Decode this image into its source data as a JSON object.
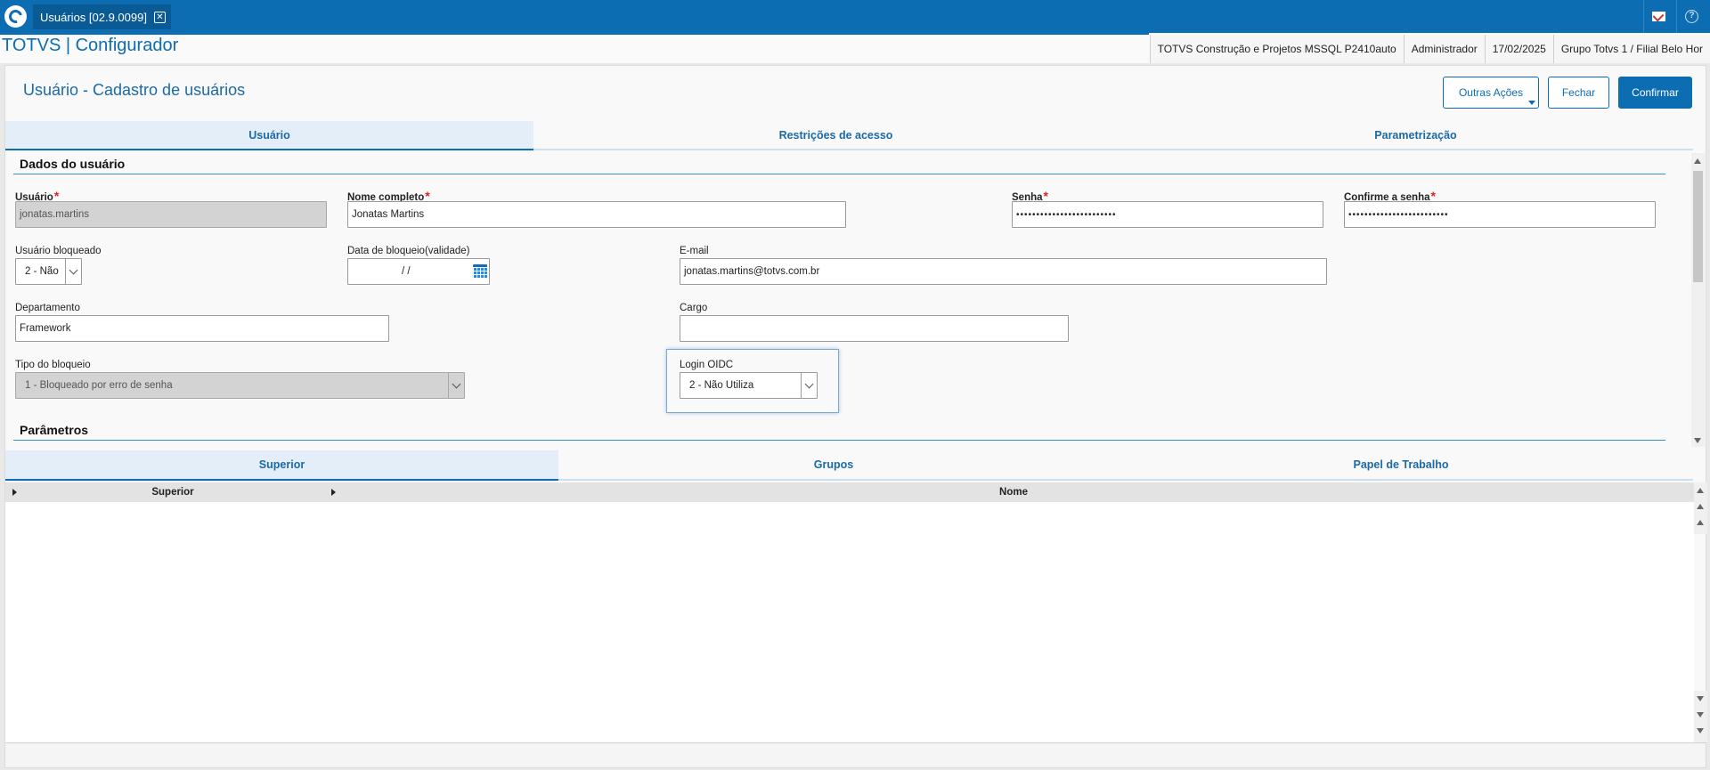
{
  "window": {
    "tab_title": "Usuários [02.9.0099]",
    "close_glyph": "✕",
    "help_glyph": "?"
  },
  "header": {
    "app_title": "TOTVS | Configurador",
    "environment": "TOTVS Construção e Projetos MSSQL P2410auto",
    "user": "Administrador",
    "date": "17/02/2025",
    "company": "Grupo Totvs 1 / Filial Belo Hor"
  },
  "form": {
    "title": "Usuário - Cadastro de usuários",
    "buttons": {
      "other_actions": "Outras Ações",
      "close": "Fechar",
      "confirm": "Confirmar"
    }
  },
  "tabs": [
    {
      "label": "Usuário",
      "active": true
    },
    {
      "label": "Restrições de acesso",
      "active": false
    },
    {
      "label": "Parametrização",
      "active": false
    }
  ],
  "user_section": {
    "title": "Dados do usuário",
    "required_mark": "*",
    "fields": {
      "usuario": {
        "label": "Usuário",
        "value": "jonatas.martins"
      },
      "nome_completo": {
        "label": "Nome completo",
        "value": "Jonatas Martins"
      },
      "senha": {
        "label": "Senha",
        "value": "•••••••••••••••••••••••••"
      },
      "confirme_senha": {
        "label": "Confirme a senha",
        "value": "•••••••••••••••••••••••••"
      },
      "usuario_bloqueado": {
        "label": "Usuário bloqueado",
        "value": "2 - Não"
      },
      "data_bloqueio": {
        "label": "Data de bloqueio(validade)",
        "value": "/ /"
      },
      "email": {
        "label": "E-mail",
        "value": "jonatas.martins@totvs.com.br"
      },
      "departamento": {
        "label": "Departamento",
        "value": "Framework"
      },
      "cargo": {
        "label": "Cargo",
        "value": ""
      },
      "tipo_bloqueio": {
        "label": "Tipo do bloqueio",
        "value": "1 - Bloqueado por erro de senha"
      },
      "login_oidc": {
        "label": "Login OIDC",
        "value": "2 - Não Utiliza"
      }
    }
  },
  "params_section": {
    "title": "Parâmetros",
    "tabs": [
      {
        "label": "Superior",
        "active": true
      },
      {
        "label": "Grupos",
        "active": false
      },
      {
        "label": "Papel de Trabalho",
        "active": false
      }
    ],
    "grid": {
      "columns": [
        "Superior",
        "Nome"
      ],
      "rows": []
    }
  },
  "colors": {
    "brand": "#0d6db3",
    "required": "#e02020"
  }
}
